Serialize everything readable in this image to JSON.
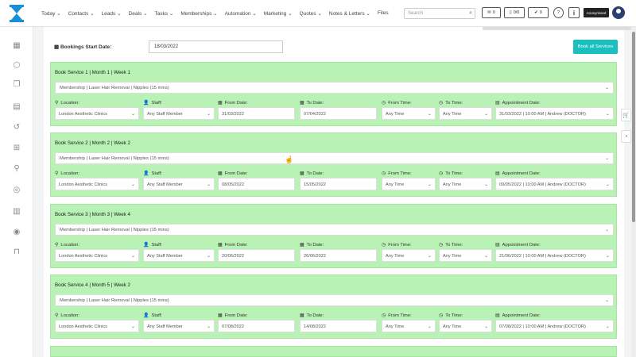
{
  "nav": {
    "items": [
      "Today",
      "Contacts",
      "Leads",
      "Deals",
      "Tasks",
      "Memberships",
      "Automation",
      "Marketing",
      "Quotes",
      "Notes & Letters",
      "Files"
    ],
    "search_placeholder": "Search",
    "mail_count": "0",
    "call_count": "0/0",
    "task_count": "0",
    "account_badge": "Anonymised"
  },
  "page": {
    "bookings_start_label": "Bookings Start Date:",
    "bookings_start_value": "18/03/2022",
    "book_all_label": "Book all Services",
    "field_labels": {
      "location": "Location:",
      "staff": "Staff:",
      "from_date": "From Date:",
      "to_date": "To Date:",
      "from_time": "From Time:",
      "to_time": "To Time:",
      "appointment_date": "Appointment Date:"
    },
    "services": [
      {
        "title": "Book Service 1 | Month 1 | Week 1",
        "membership": "Membership | Laser Hair Removal | Nipples (15 mins)",
        "location": "London Aesthetic Clinics",
        "staff": "Any Staff Member",
        "from_date": "31/03/2022",
        "to_date": "07/04/2022",
        "from_time": "Any Time",
        "to_time": "Any Time",
        "appointment": "31/03/2022 | 10:00 AM | Andrew (DOCTOR)"
      },
      {
        "title": "Book Service 2 | Month 2 | Week 2",
        "membership": "Membership | Laser Hair Removal | Nipples (15 mins)",
        "location": "London Aesthetic Clinics",
        "staff": "Any Staff Member",
        "from_date": "08/05/2022",
        "to_date": "15/05/2022",
        "from_time": "Any Time",
        "to_time": "Any Time",
        "appointment": "09/05/2022 | 10:00 AM | Andrew (DOCTOR)"
      },
      {
        "title": "Book Service 3 | Month 3 | Week 4",
        "membership": "Membership | Laser Hair Removal | Nipples (15 mins)",
        "location": "London Aesthetic Clinics",
        "staff": "Any Staff Member",
        "from_date": "20/06/2022",
        "to_date": "26/06/2022",
        "from_time": "Any Time",
        "to_time": "Any Time",
        "appointment": "21/06/2022 | 10:00 AM | Andrew (DOCTOR)"
      },
      {
        "title": "Book Service 4 | Month 5 | Week 2",
        "membership": "Membership | Laser Hair Removal | Nipples (15 mins)",
        "location": "London Aesthetic Clinics",
        "staff": "Any Staff Member",
        "from_date": "07/08/2022",
        "to_date": "14/08/2022",
        "from_time": "Any Time",
        "to_time": "Any Time",
        "appointment": "07/08/2022 | 10:00 AM | Andrew (DOCTOR)"
      }
    ]
  },
  "colors": {
    "card_bg": "#b8f2b4",
    "button": "#1bbfbf"
  }
}
